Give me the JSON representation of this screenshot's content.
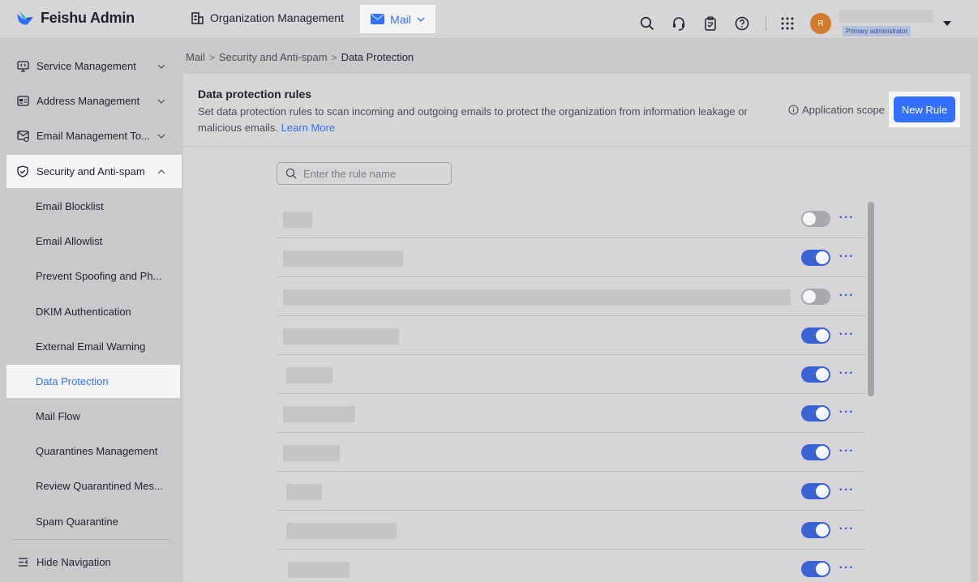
{
  "header": {
    "logo_text": "Feishu Admin",
    "nav_org_label": "Organization Management",
    "nav_mail_label": "Mail",
    "avatar_initial": "R",
    "role_badge": "Primary administrator"
  },
  "sidebar": {
    "items": [
      {
        "label": "Service Management"
      },
      {
        "label": "Address Management"
      },
      {
        "label": "Email Management To..."
      },
      {
        "label": "Security and Anti-spam"
      }
    ],
    "sub_items": [
      {
        "label": "Email Blocklist"
      },
      {
        "label": "Email Allowlist"
      },
      {
        "label": "Prevent Spoofing and Ph..."
      },
      {
        "label": "DKIM Authentication"
      },
      {
        "label": "External Email Warning"
      },
      {
        "label": "Data Protection"
      },
      {
        "label": "Mail Flow"
      },
      {
        "label": "Quarantines Management"
      },
      {
        "label": "Review Quarantined Mes..."
      },
      {
        "label": "Spam Quarantine"
      }
    ],
    "hide_nav_label": "Hide Navigation"
  },
  "breadcrumb": {
    "items": [
      "Mail",
      "Security and Anti-spam",
      "Data Protection"
    ]
  },
  "main": {
    "title": "Data protection rules",
    "description": "Set data protection rules to scan incoming and outgoing emails to protect the organization from information leakage or malicious emails.",
    "learn_more": "Learn More",
    "application_scope": "Application scope",
    "new_rule_label": "New Rule",
    "search_placeholder": "Enter the rule name",
    "rules": [
      {
        "enabled": false
      },
      {
        "enabled": true
      },
      {
        "enabled": false
      },
      {
        "enabled": true
      },
      {
        "enabled": true
      },
      {
        "enabled": true
      },
      {
        "enabled": true
      },
      {
        "enabled": true
      },
      {
        "enabled": true
      },
      {
        "enabled": true
      }
    ]
  },
  "colors": {
    "accent": "#3370ff",
    "toggle_on": "#3a64d6",
    "toggle_off": "#a8a9ac"
  }
}
